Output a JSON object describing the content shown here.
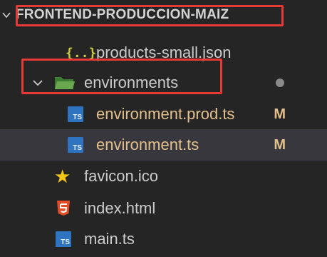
{
  "header": {
    "title": "FRONTEND-PRODUCCION-MAIZ",
    "twist": "chevron-down-icon"
  },
  "tree": {
    "items": [
      {
        "label": "products-small.json",
        "icon": "json-icon",
        "status": ""
      },
      {
        "label": "environments",
        "icon": "folder-open-icon",
        "expanded": true,
        "status": "dot"
      },
      {
        "label": "environment.prod.ts",
        "icon": "ts-icon",
        "status": "M"
      },
      {
        "label": "environment.ts",
        "icon": "ts-icon",
        "status": "M",
        "selected": true
      },
      {
        "label": "favicon.ico",
        "icon": "star-icon",
        "status": ""
      },
      {
        "label": "index.html",
        "icon": "html5-icon",
        "status": ""
      },
      {
        "label": "main.ts",
        "icon": "ts-icon",
        "status": ""
      }
    ],
    "json_glyph": "{..}",
    "ts_glyph": "TS",
    "star_glyph": "★",
    "m_badge": "M"
  },
  "colors": {
    "background": "#252526",
    "selected_row": "#37373d",
    "highlight_border": "#e53935",
    "modified": "#e2c08d",
    "ts_blue": "#2f74c0",
    "json_yellow": "#cbcb41",
    "html_orange": "#e44d26",
    "folder_green": "#6aa84f"
  }
}
